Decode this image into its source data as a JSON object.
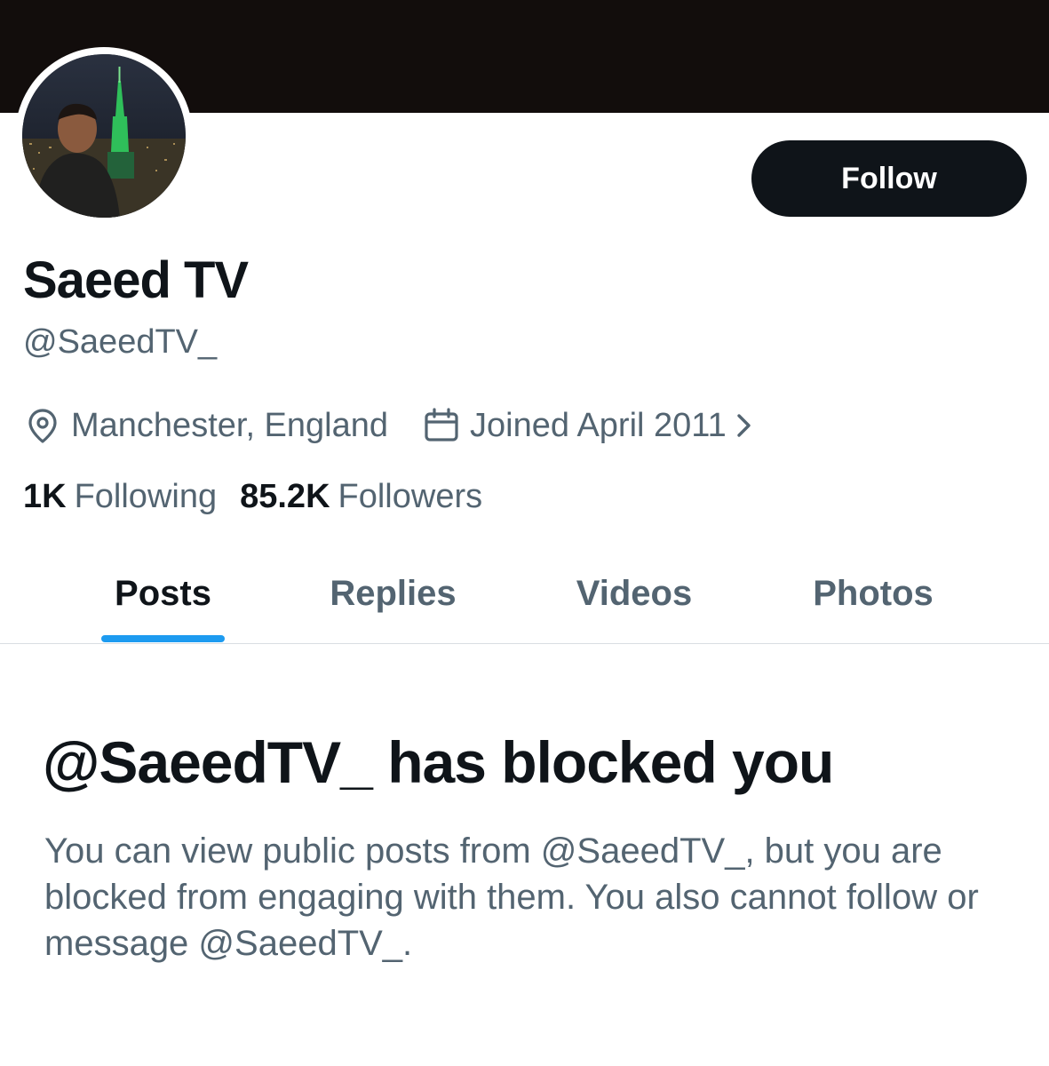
{
  "profile": {
    "display_name": "Saeed TV",
    "handle": "@SaeedTV_",
    "location": "Manchester, England",
    "joined": "Joined April 2011",
    "following_count": "1K",
    "following_label": "Following",
    "followers_count": "85.2K",
    "followers_label": "Followers"
  },
  "actions": {
    "follow_label": "Follow"
  },
  "tabs": [
    {
      "label": "Posts",
      "active": true
    },
    {
      "label": "Replies",
      "active": false
    },
    {
      "label": "Videos",
      "active": false
    },
    {
      "label": "Photos",
      "active": false
    }
  ],
  "blocked": {
    "title": "@SaeedTV_ has blocked you",
    "message": "You can view public posts from @SaeedTV_, but you are blocked from engaging with them. You also cannot follow or message @SaeedTV_."
  },
  "icons": {
    "location": "location-pin-icon",
    "calendar": "calendar-icon",
    "chevron": "chevron-right-icon"
  },
  "colors": {
    "text_primary": "#0f1419",
    "text_secondary": "#536471",
    "accent": "#1d9bf0",
    "follow_button": "#0f1419",
    "banner": "#120d0c"
  }
}
